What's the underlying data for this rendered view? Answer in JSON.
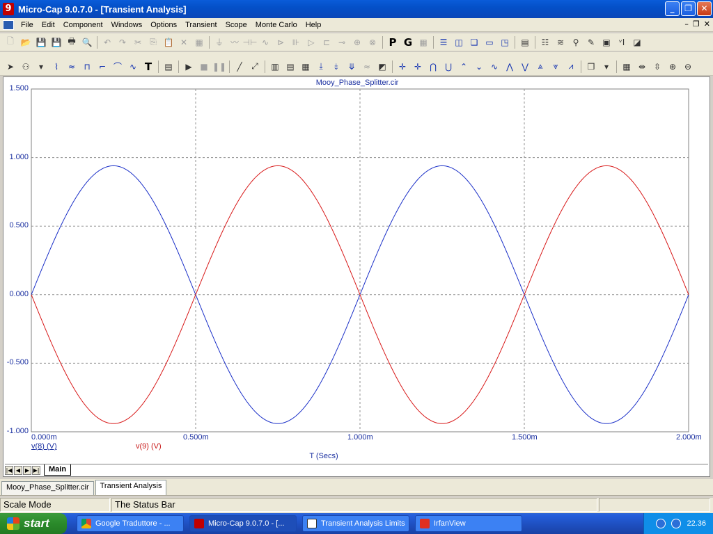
{
  "window": {
    "title": "Micro-Cap 9.0.7.0 - [Transient Analysis]",
    "app_icon_letter": "9"
  },
  "menu": {
    "items": [
      "File",
      "Edit",
      "Component",
      "Windows",
      "Options",
      "Transient",
      "Scope",
      "Monte Carlo",
      "Help"
    ]
  },
  "toolbar2": {
    "p_label": "P",
    "g_label": "G"
  },
  "chart_data": {
    "type": "line",
    "title": "Mooy_Phase_Splitter.cir",
    "xlabel": "T (Secs)",
    "ylabel": "",
    "xlim": [
      0,
      2.0
    ],
    "ylim": [
      -1.0,
      1.5
    ],
    "x_unit_note": "m",
    "x_ticks": [
      "0.000m",
      "0.500m",
      "1.000m",
      "1.500m",
      "2.000m"
    ],
    "y_ticks": [
      "1.500",
      "1.000",
      "0.500",
      "0.000",
      "-0.500",
      "-1.000"
    ],
    "grid": true,
    "series": [
      {
        "name": "v(8) (V)",
        "color": "#1a2fc8",
        "x": [
          0,
          0.125,
          0.25,
          0.375,
          0.5,
          0.625,
          0.75,
          0.875,
          1.0,
          1.125,
          1.25,
          1.375,
          1.5,
          1.625,
          1.75,
          1.875,
          2.0
        ],
        "y": [
          0,
          0.665,
          0.94,
          0.665,
          0,
          -0.665,
          -0.94,
          -0.665,
          0,
          0.665,
          0.94,
          0.665,
          0,
          -0.665,
          -0.94,
          -0.665,
          0
        ]
      },
      {
        "name": "v(9) (V)",
        "color": "#d81818",
        "x": [
          0,
          0.125,
          0.25,
          0.375,
          0.5,
          0.625,
          0.75,
          0.875,
          1.0,
          1.125,
          1.25,
          1.375,
          1.5,
          1.625,
          1.75,
          1.875,
          2.0
        ],
        "y": [
          0,
          -0.665,
          -0.94,
          -0.665,
          0,
          0.665,
          0.94,
          0.665,
          0,
          -0.665,
          -0.94,
          -0.665,
          0,
          0.665,
          0.94,
          0.665,
          0
        ]
      }
    ]
  },
  "tabs": {
    "main_tab": "Main"
  },
  "doc_tabs": [
    "Mooy_Phase_Splitter.cir",
    "Transient Analysis"
  ],
  "status": {
    "mode": "Scale Mode",
    "message": "The Status Bar"
  },
  "taskbar": {
    "start_label": "start",
    "items": [
      {
        "label": "Google Traduttore - ..."
      },
      {
        "label": "Micro-Cap 9.0.7.0 - [..."
      },
      {
        "label": "Transient Analysis Limits"
      },
      {
        "label": "IrfanView"
      }
    ],
    "clock": "22.36"
  }
}
